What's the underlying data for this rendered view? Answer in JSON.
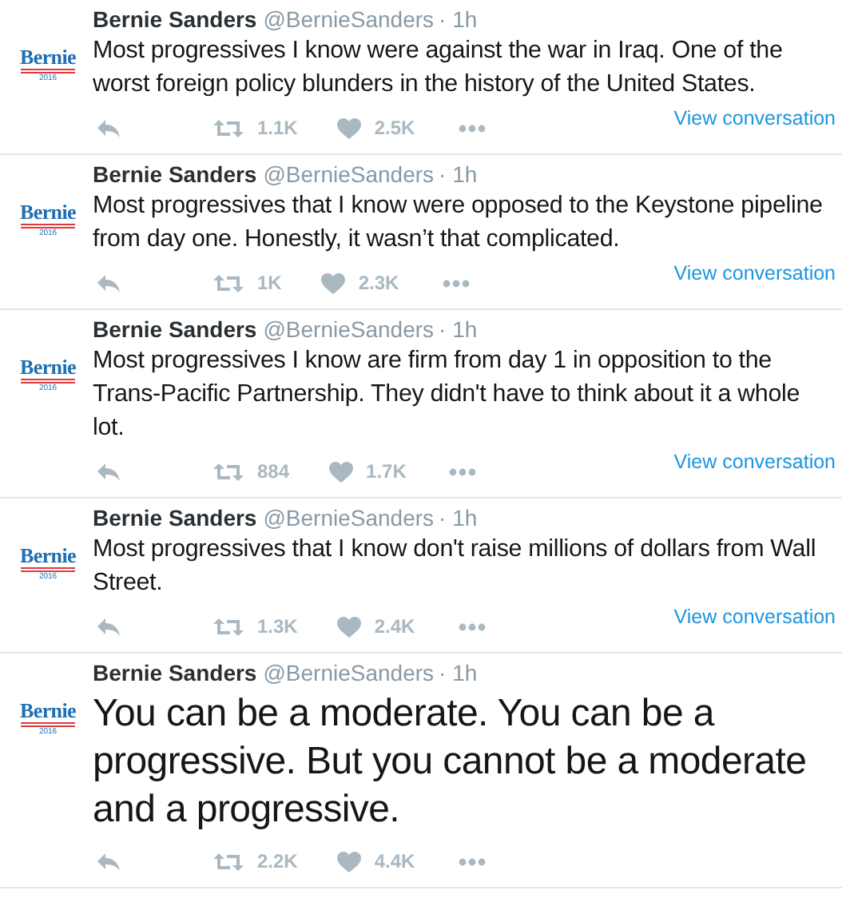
{
  "tweets": [
    {
      "kind": "normal",
      "avatar": {
        "name": "Bernie",
        "year": "2016"
      },
      "name": "Bernie Sanders",
      "handle": "@BernieSanders",
      "time": "· 1h",
      "text": "Most progressives I know were against the war in Iraq. One of the worst foreign policy blunders in the history of the United States.",
      "retweets": "1.1K",
      "likes": "2.5K",
      "link": "View conversation"
    },
    {
      "kind": "normal",
      "avatar": {
        "name": "Bernie",
        "year": "2016"
      },
      "name": "Bernie Sanders",
      "handle": "@BernieSanders",
      "time": "· 1h",
      "text": "Most progressives that I know were opposed to the Keystone pipeline from day one. Honestly, it wasn’t that complicated.",
      "retweets": "1K",
      "likes": "2.3K",
      "link": "View conversation"
    },
    {
      "kind": "normal",
      "avatar": {
        "name": "Bernie",
        "year": "2016"
      },
      "name": "Bernie Sanders",
      "handle": "@BernieSanders",
      "time": "· 1h",
      "text": "Most progressives I know are firm from day 1 in opposition to the Trans-Pacific Partnership. They didn't have to think about it a whole lot.",
      "retweets": "884",
      "likes": "1.7K",
      "link": "View conversation"
    },
    {
      "kind": "normal",
      "avatar": {
        "name": "Bernie",
        "year": "2016"
      },
      "name": "Bernie Sanders",
      "handle": "@BernieSanders",
      "time": "· 1h",
      "text": "Most progressives that I know don't raise millions of dollars from Wall Street.",
      "retweets": "1.3K",
      "likes": "2.4K",
      "link": "View conversation"
    },
    {
      "kind": "large",
      "avatar": {
        "name": "Bernie",
        "year": "2016"
      },
      "name": "Bernie Sanders",
      "handle": "@BernieSanders",
      "time": "· 1h",
      "text": "You can be a moderate. You can be a progressive. But you cannot be a moderate and a progressive.",
      "retweets": "2.2K",
      "likes": "4.4K"
    }
  ]
}
